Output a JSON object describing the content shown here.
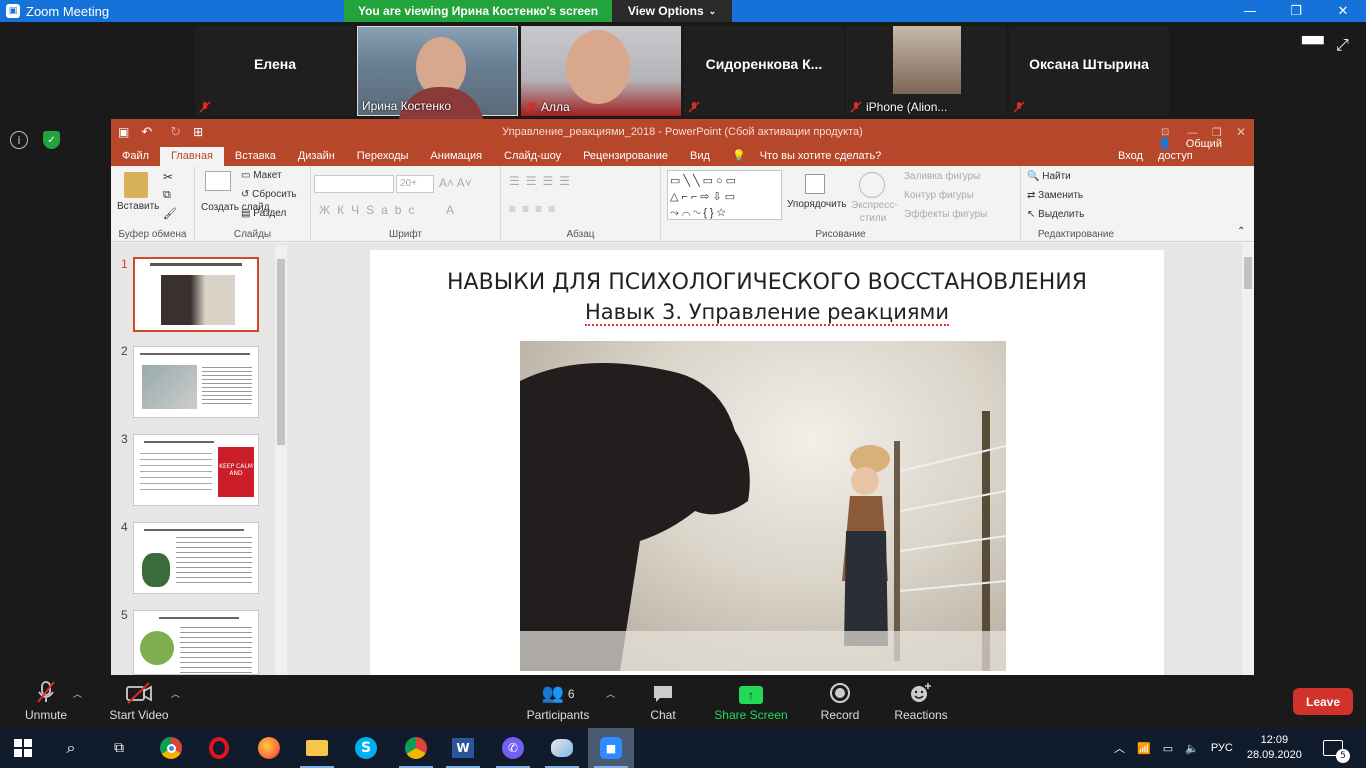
{
  "window": {
    "title": "Zoom Meeting",
    "viewing_banner": "You are viewing Ирина Костенко's screen",
    "view_options": "View Options"
  },
  "gallery": [
    {
      "name": "Елена",
      "type": "name"
    },
    {
      "name": "Ирина Костенко",
      "type": "video"
    },
    {
      "name": "Алла",
      "type": "video"
    },
    {
      "name": "Сидоренкова  К...",
      "type": "name"
    },
    {
      "name": "iPhone (Alion...",
      "type": "video"
    },
    {
      "name": "Оксана Штырина",
      "type": "name"
    }
  ],
  "ppt": {
    "title": "Управление_реакциями_2018 - PowerPoint (Сбой активации продукта)",
    "tabs": [
      "Файл",
      "Главная",
      "Вставка",
      "Дизайн",
      "Переходы",
      "Анимация",
      "Слайд-шоу",
      "Рецензирование",
      "Вид"
    ],
    "tell_me": "Что вы хотите сделать?",
    "signin": "Вход",
    "share": "Общий доступ",
    "ribbon": {
      "paste": "Вставить",
      "clipboard": "Буфер обмена",
      "create_slide": "Создать слайд",
      "layout": "Макет",
      "reset": "Сбросить",
      "section": "Раздел",
      "slides": "Слайды",
      "font_size": "20+",
      "font": "Шрифт",
      "paragraph": "Абзац",
      "arrange": "Упорядочить",
      "quick_styles": "Экспресс-стили",
      "shape_fill": "Заливка фигуры",
      "shape_outline": "Контур фигуры",
      "shape_effects": "Эффекты фигуры",
      "drawing": "Рисование",
      "find": "Найти",
      "replace": "Заменить",
      "select": "Выделить",
      "editing": "Редактирование"
    },
    "slide_numbers": [
      "1",
      "2",
      "3",
      "4",
      "5"
    ],
    "thumb3_text": "KEEP CALM AND",
    "slide": {
      "title": "НАВЫКИ ДЛЯ ПСИХОЛОГИЧЕСКОГО ВОССТАНОВЛЕНИЯ",
      "subtitle": "Навык 3. Управление реакциями"
    }
  },
  "controls": {
    "unmute": "Unmute",
    "start_video": "Start Video",
    "participants": "Participants",
    "participants_count": "6",
    "chat": "Chat",
    "share_screen": "Share Screen",
    "record": "Record",
    "reactions": "Reactions",
    "leave": "Leave"
  },
  "taskbar": {
    "lang": "РУС",
    "time": "12:09",
    "date": "28.09.2020",
    "notifications": "5"
  },
  "colors": {
    "zoom_blue": "#1572d8",
    "banner_green": "#23a33c",
    "ppt_orange": "#b7472a",
    "leave_red": "#d1322a",
    "share_green": "#23d959"
  }
}
